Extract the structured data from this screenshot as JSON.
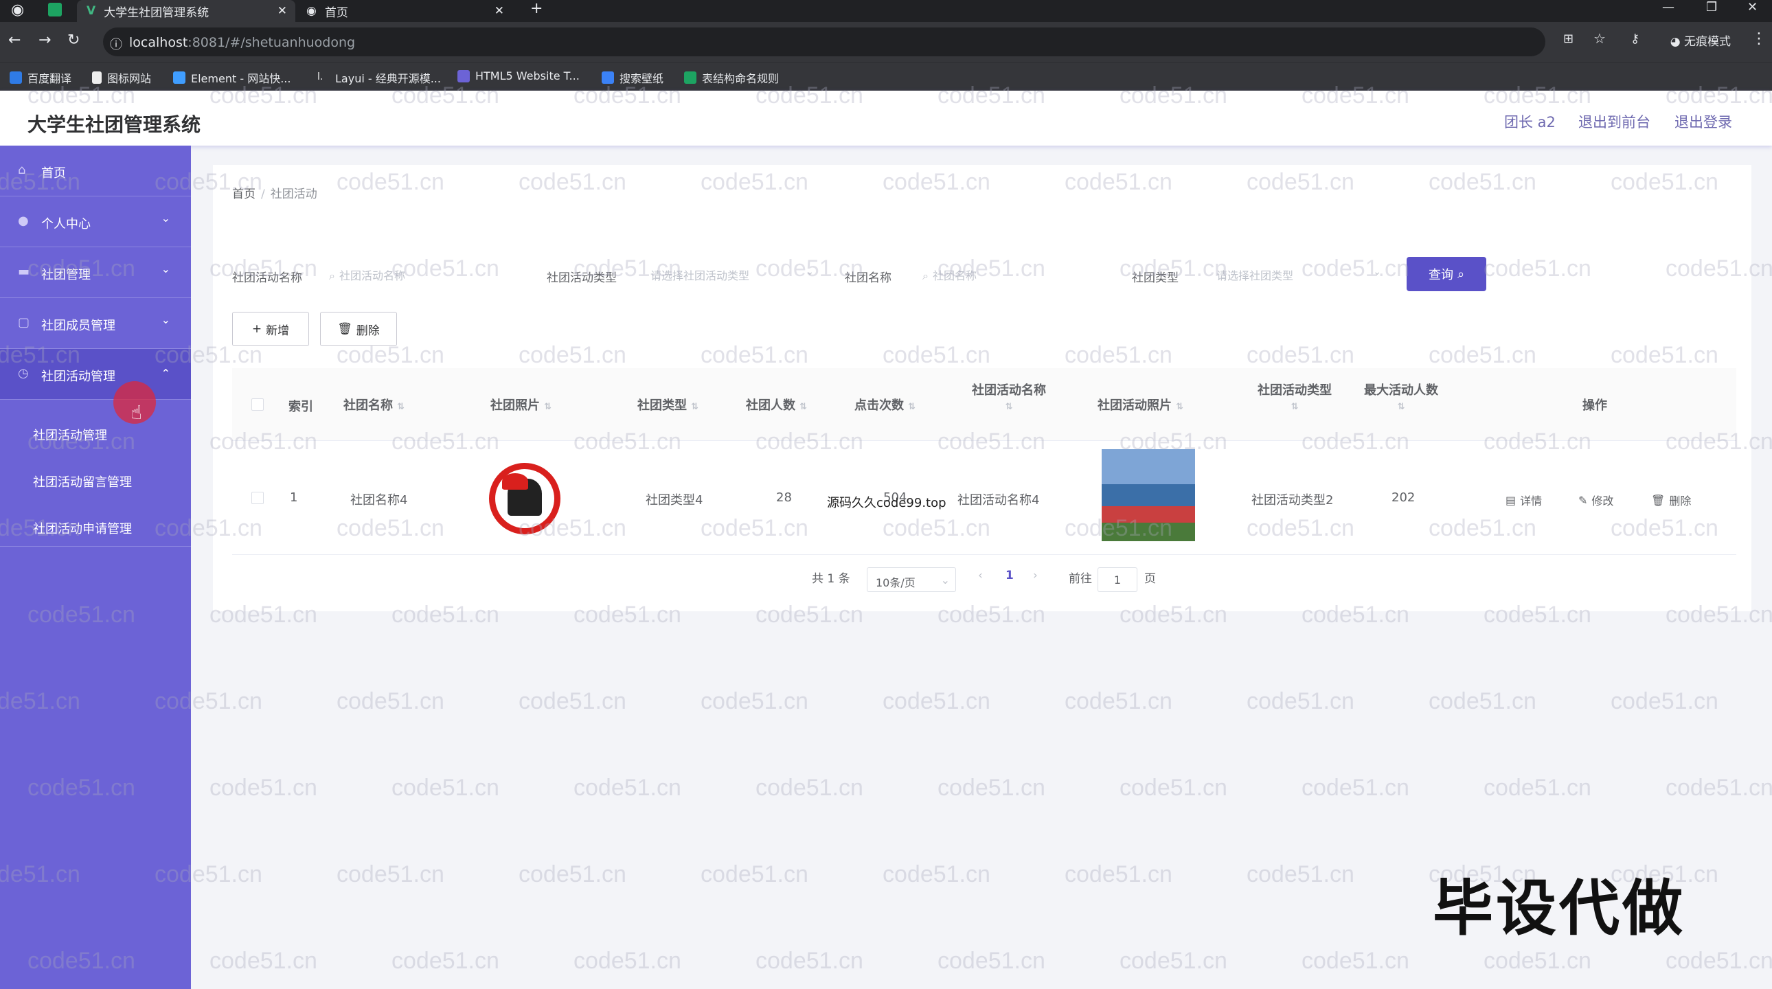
{
  "browser": {
    "tabs": [
      {
        "label": "大学生社团管理系统"
      },
      {
        "label": "首页"
      }
    ],
    "url_host": "localhost",
    "url_path": ":8081/#/shetuanhuodong",
    "incognito_label": "无痕模式",
    "bookmarks": [
      {
        "label": "百度翻译"
      },
      {
        "label": "图标网站"
      },
      {
        "label": "Element - 网站快..."
      },
      {
        "label": "Layui - 经典开源模..."
      },
      {
        "label": "HTML5 Website T..."
      },
      {
        "label": "搜索壁纸"
      },
      {
        "label": "表结构命名规则"
      }
    ]
  },
  "header": {
    "title": "大学生社团管理系统",
    "user": "团长 a2",
    "to_front": "退出到前台",
    "logout": "退出登录"
  },
  "sidebar": {
    "items": [
      {
        "label": "首页"
      },
      {
        "label": "个人中心"
      },
      {
        "label": "社团管理"
      },
      {
        "label": "社团成员管理"
      },
      {
        "label": "社团活动管理"
      }
    ],
    "submenu": [
      {
        "label": "社团活动管理"
      },
      {
        "label": "社团活动留言管理"
      },
      {
        "label": "社团活动申请管理"
      }
    ]
  },
  "breadcrumb": {
    "home": "首页",
    "current": "社团活动"
  },
  "search": {
    "activity_name_label": "社团活动名称",
    "activity_name_placeholder": "社团活动名称",
    "activity_type_label": "社团活动类型",
    "activity_type_placeholder": "请选择社团活动类型",
    "club_name_label": "社团名称",
    "club_name_placeholder": "社团名称",
    "club_type_label": "社团类型",
    "club_type_placeholder": "请选择社团类型",
    "query_button": "查询"
  },
  "toolbar": {
    "add": "新增",
    "delete": "删除"
  },
  "table": {
    "headers": [
      "索引",
      "社团名称",
      "社团照片",
      "社团类型",
      "社团人数",
      "点击次数",
      "社团活动名称",
      "社团活动照片",
      "社团活动类型",
      "最大活动人数",
      "操作"
    ],
    "rows": [
      {
        "index": "1",
        "club_name": "社团名称4",
        "club_type": "社团类型4",
        "members": "28",
        "clicks": "504",
        "activity_name": "社团活动名称4",
        "activity_type": "社团活动类型2",
        "max_people": "202"
      }
    ],
    "actions": {
      "detail": "详情",
      "edit": "修改",
      "delete": "删除"
    }
  },
  "overlay_text": "源码久久code99.top",
  "pagination": {
    "total": "共 1 条",
    "page_size": "10条/页",
    "current_page": "1",
    "goto_label": "前往",
    "goto_value": "1",
    "page_suffix": "页"
  },
  "watermark": "code51.cn",
  "promo_text": "毕设代做"
}
